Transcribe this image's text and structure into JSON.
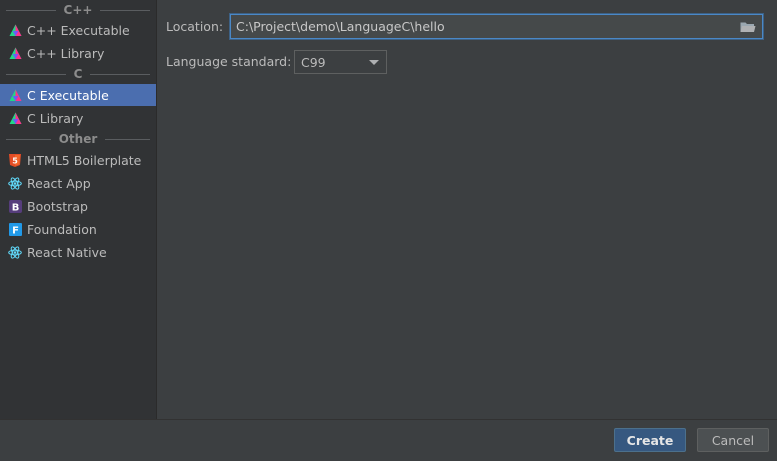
{
  "sidebar": {
    "groups": [
      {
        "title": "C++"
      },
      {
        "title": "C"
      },
      {
        "title": "Other"
      }
    ],
    "items": [
      {
        "label": "C++ Executable",
        "icon": "clion-icon"
      },
      {
        "label": "C++ Library",
        "icon": "clion-icon"
      },
      {
        "label": "C Executable",
        "icon": "clion-icon",
        "selected": true
      },
      {
        "label": "C Library",
        "icon": "clion-icon"
      },
      {
        "label": "HTML5 Boilerplate",
        "icon": "html5-icon"
      },
      {
        "label": "React App",
        "icon": "react-icon"
      },
      {
        "label": "Bootstrap",
        "icon": "bootstrap-icon"
      },
      {
        "label": "Foundation",
        "icon": "foundation-icon"
      },
      {
        "label": "React Native",
        "icon": "react-icon"
      }
    ]
  },
  "form": {
    "location_label": "Location:",
    "location_value": "C:\\Project\\demo\\LanguageC\\hello",
    "language_label": "Language standard:",
    "language_value": "C99"
  },
  "buttons": {
    "create": "Create",
    "cancel": "Cancel"
  },
  "colors": {
    "background": "#3c3f41",
    "sidebar": "#313335",
    "selection": "#4b6eaf",
    "focus": "#4a88c7",
    "html5": "#e44d26",
    "react": "#61dafb",
    "bootstrap": "#563d7c",
    "foundation": "#2199e8"
  }
}
